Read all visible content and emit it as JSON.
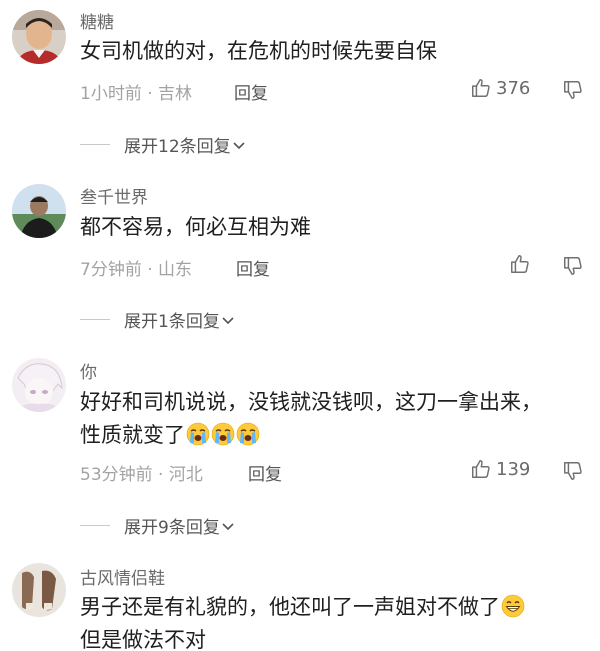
{
  "comments": [
    {
      "username": "糖糖",
      "text": "女司机做的对，在危机的时候先要自保",
      "meta": "1小时前 · 吉林",
      "reply_label": "回复",
      "likes": "376",
      "expand_label": "展开12条回复"
    },
    {
      "username": "叁千世界",
      "text": "都不容易，何必互相为难",
      "meta": "7分钟前 · 山东",
      "reply_label": "回复",
      "likes": "",
      "expand_label": "展开1条回复"
    },
    {
      "username": "你",
      "text_line1": "好好和司机说说，没钱就没钱呗，这刀一拿出来，",
      "text_line2": "性质就变了",
      "meta": "53分钟前 · 河北",
      "reply_label": "回复",
      "likes": "139",
      "expand_label": "展开9条回复"
    },
    {
      "username": "古风情侣鞋",
      "text_line1": "男子还是有礼貌的，他还叫了一声姐对不做了",
      "text_line2": "但是做法不对"
    }
  ],
  "icons": {
    "like": "thumbs-up-icon",
    "dislike": "thumbs-down-icon",
    "expand": "chevron-down-icon",
    "crying": "loudly-crying-emoji",
    "grin": "grinning-emoji"
  }
}
